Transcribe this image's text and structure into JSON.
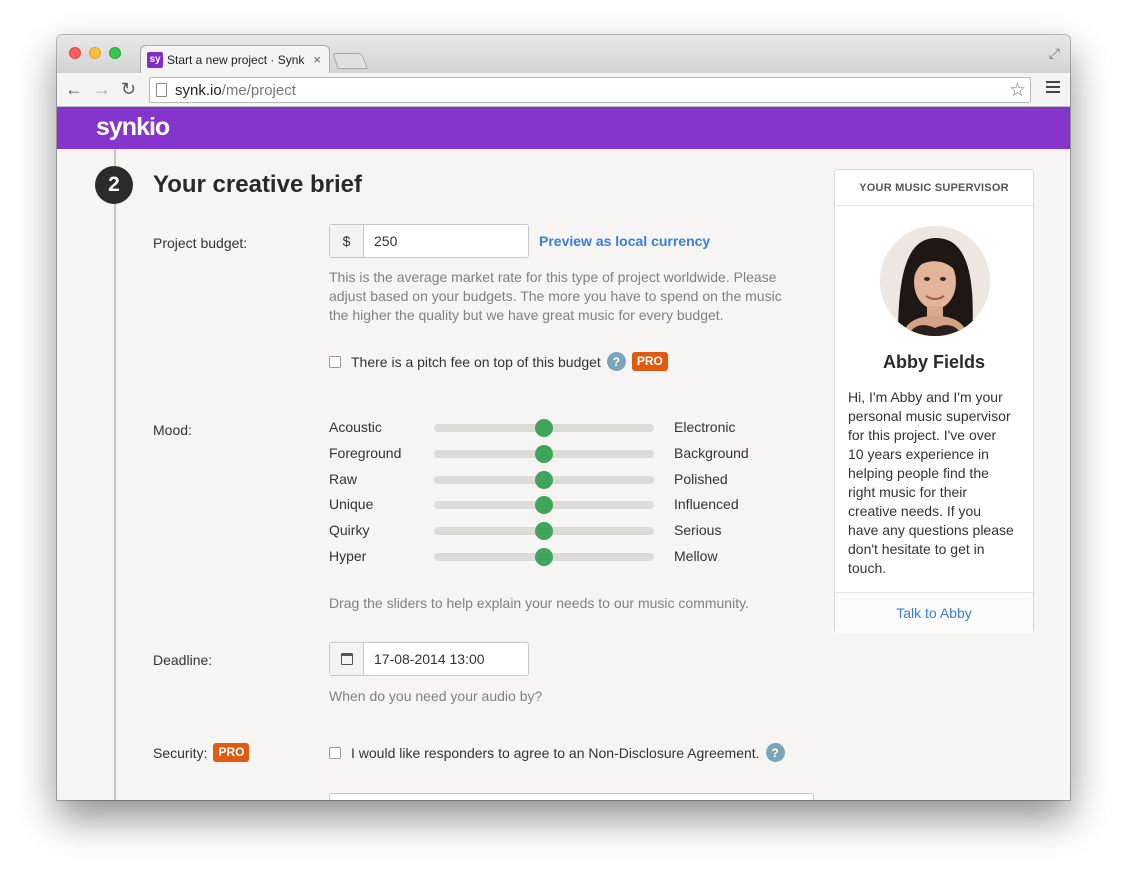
{
  "browser": {
    "favicon_text": "sy",
    "tab_title": "Start a new project · Synk",
    "tab_close": "×",
    "url_host": "synk.io",
    "url_path": "/me/project"
  },
  "header": {
    "logo": "synkio"
  },
  "step": {
    "number": "2",
    "title": "Your creative brief"
  },
  "budget": {
    "label": "Project budget:",
    "currency_symbol": "$",
    "value": "250",
    "preview_link": "Preview as local currency",
    "help_lines": [
      "This is the average market rate for this type of project worldwide. Please",
      "adjust based on your budgets. The more you have to spend on the music",
      "the higher the quality but we have great music for every budget."
    ],
    "pitch_fee_label": "There is a pitch fee on top of this budget",
    "help_icon": "?",
    "pro_badge": "PRO"
  },
  "mood": {
    "label": "Mood:",
    "sliders": [
      {
        "left": "Acoustic",
        "right": "Electronic",
        "value": 0.5
      },
      {
        "left": "Foreground",
        "right": "Background",
        "value": 0.5
      },
      {
        "left": "Raw",
        "right": "Polished",
        "value": 0.5
      },
      {
        "left": "Unique",
        "right": "Influenced",
        "value": 0.5
      },
      {
        "left": "Quirky",
        "right": "Serious",
        "value": 0.5
      },
      {
        "left": "Hyper",
        "right": "Mellow",
        "value": 0.5
      }
    ],
    "help": "Drag the sliders to help explain your needs to our music community."
  },
  "deadline": {
    "label": "Deadline:",
    "value": "17-08-2014 13:00",
    "help": "When do you need your audio by?"
  },
  "security": {
    "label": "Security:",
    "pro_badge": "PRO",
    "nda_label": "I would like responders to agree to an Non-Disclosure Agreement.",
    "help_icon": "?"
  },
  "supervisor": {
    "heading": "YOUR MUSIC SUPERVISOR",
    "name": "Abby Fields",
    "bio_lines": [
      "Hi, I'm Abby and I'm your",
      "personal music supervisor",
      "for this project. I've over",
      "10 years experience in",
      "helping people find the",
      "right music for their",
      "creative needs. If you",
      "have any questions please",
      "don't hesitate to get in",
      "touch."
    ],
    "cta": "Talk to Abby"
  },
  "colors": {
    "brand_purple": "#8534cc",
    "slider_green": "#3fa55c",
    "pro_orange": "#e05a10",
    "link_blue": "#3b7dd8"
  }
}
